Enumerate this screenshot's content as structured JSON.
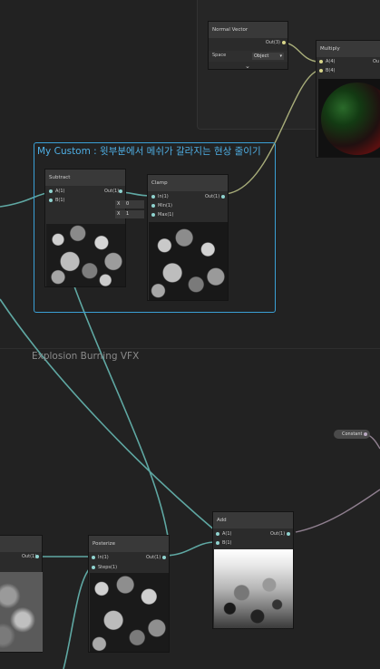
{
  "normal_vector": {
    "title": "Normal Vector",
    "output_label": "Out(3)",
    "space_label": "Space",
    "space_value": "Object"
  },
  "multiply": {
    "title": "Multiply",
    "inputs": [
      "A(4)",
      "B(4)"
    ],
    "output_label": "Ou"
  },
  "group": {
    "title": "My Custom : 윗부분에서 메쉬가 갈라지는 현상 줄이기"
  },
  "subtract": {
    "title": "Subtract",
    "inputs": [
      "A(1)",
      "B(1)"
    ],
    "output_label": "Out(1)"
  },
  "clamp": {
    "title": "Clamp",
    "inputs": [
      "In(1)",
      "Min(1)",
      "Max(1)"
    ],
    "output_label": "Out(1)",
    "min_prefix": "X",
    "min_value": "0",
    "max_prefix": "X",
    "max_value": "1"
  },
  "section": {
    "title": "Explosion Burning VFX"
  },
  "constant": {
    "label": "Constant"
  },
  "posterize": {
    "title": "Posterize",
    "inputs": [
      "In(1)",
      "Steps(1)"
    ],
    "output_label": "Out(1)"
  },
  "add": {
    "title": "Add",
    "inputs": [
      "A(1)",
      "B(1)"
    ],
    "output_label": "Out(1)"
  },
  "left_node": {
    "output_label": "Out(1)"
  },
  "colors": {
    "background": "#222222",
    "node": "#2b2b2b",
    "node_header": "#393939",
    "group_border": "#3aa0d6",
    "wire": "#5fa8a3",
    "port_vector": "#d8d58a",
    "port_float": "#8fd3cf"
  }
}
